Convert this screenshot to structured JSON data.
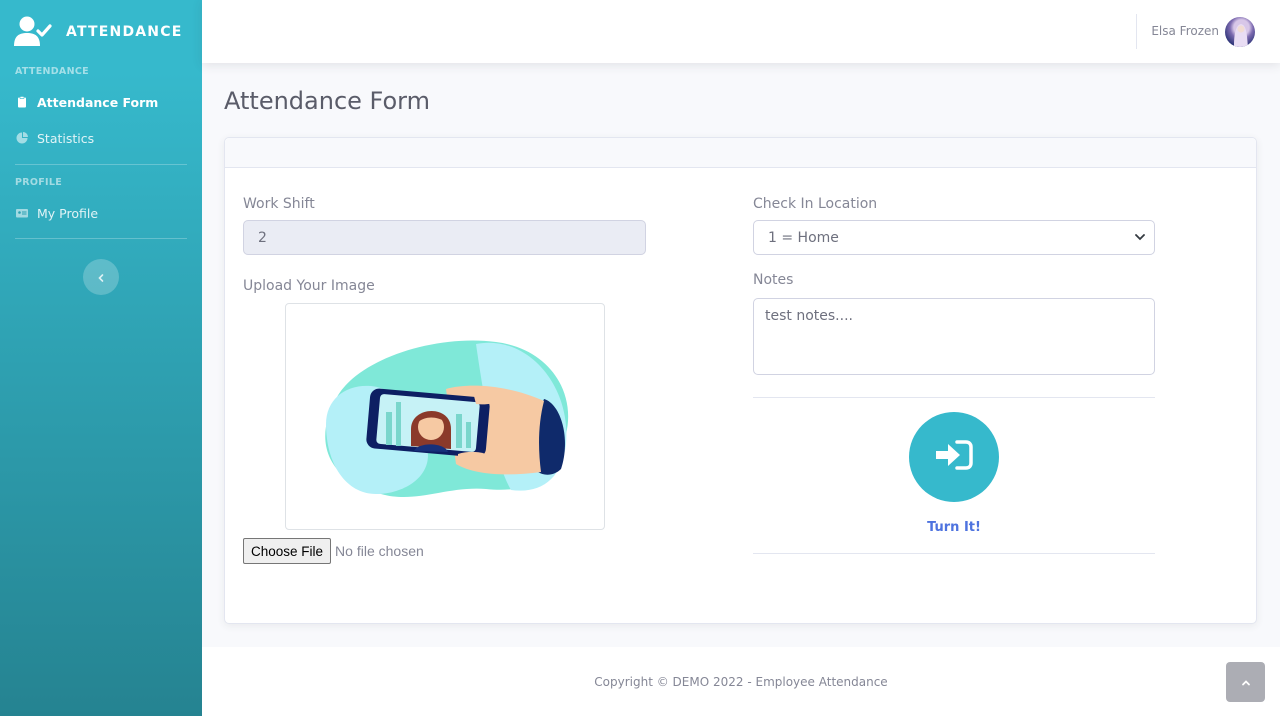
{
  "sidebar": {
    "brand": "ATTENDANCE",
    "sections": [
      {
        "heading": "ATTENDANCE"
      },
      {
        "heading": "PROFILE"
      }
    ],
    "items": [
      {
        "label": "Attendance Form",
        "icon": "clipboard-icon"
      },
      {
        "label": "Statistics",
        "icon": "chart-pie-icon"
      },
      {
        "label": "My Profile",
        "icon": "id-card-icon"
      }
    ],
    "toggle_icon": "chevron-left-icon"
  },
  "topbar": {
    "user_name": "Elsa Frozen"
  },
  "page": {
    "title": "Attendance Form"
  },
  "form": {
    "work_shift": {
      "label": "Work Shift",
      "value": "2"
    },
    "upload": {
      "label": "Upload Your Image",
      "button": "Choose File",
      "status": "No file chosen"
    },
    "location": {
      "label": "Check In Location",
      "value": "1 = Home"
    },
    "notes": {
      "label": "Notes",
      "value": "test notes...."
    },
    "submit": {
      "label": "Turn It!",
      "icon": "sign-in-icon"
    }
  },
  "footer": {
    "copyright": "Copyright © DEMO 2022 - Employee Attendance"
  },
  "colors": {
    "sidebar_top": "#36b9cc",
    "sidebar_bottom": "#258391",
    "primary": "#4e73df",
    "info": "#36b9cc"
  }
}
